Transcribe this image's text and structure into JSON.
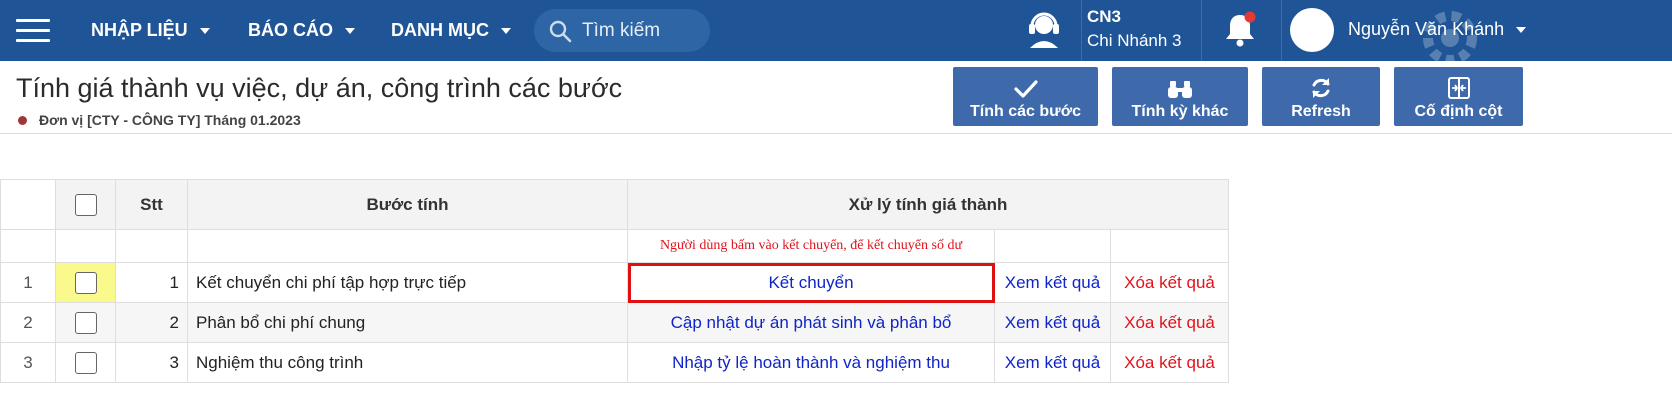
{
  "nav": {
    "menus": [
      {
        "label": "NHẬP LIỆU"
      },
      {
        "label": "BÁO CÁO"
      },
      {
        "label": "DANH MỤC"
      }
    ],
    "search_placeholder": "Tìm kiếm",
    "branch_code": "CN3",
    "branch_name": "Chi Nhánh 3",
    "user_name": "Nguyễn Văn Khánh",
    "colors": {
      "bar": "#1f5597",
      "notification_dot": "#e53935"
    }
  },
  "header": {
    "title": "Tính giá thành vụ việc, dự án, công trình các bước",
    "subtitle": "Đơn vị [CTY - CÔNG TY] Tháng 01.2023"
  },
  "actions": [
    {
      "label": "Tính các bước",
      "icon": "check-icon"
    },
    {
      "label": "Tính kỳ khác",
      "icon": "binoculars-icon"
    },
    {
      "label": "Refresh",
      "icon": "refresh-icon"
    },
    {
      "label": "Cố định cột",
      "icon": "freeze-column-icon"
    }
  ],
  "grid": {
    "headers": {
      "stt": "Stt",
      "step": "Bước tính",
      "process": "Xử lý tính giá thành"
    },
    "note": "Người dùng bấm vào kết chuyển, để kết chuyển số dư",
    "rows": [
      {
        "num": "1",
        "stt": "1",
        "step": "Kết chuyển chi phí tập hợp trực tiếp",
        "action": "Kết chuyển",
        "view": "Xem kết quả",
        "delete": "Xóa kết quả"
      },
      {
        "num": "2",
        "stt": "2",
        "step": "Phân bổ chi phí chung",
        "action": "Cập nhật dự án phát sinh và phân bổ",
        "view": "Xem kết quả",
        "delete": "Xóa kết quả"
      },
      {
        "num": "3",
        "stt": "3",
        "step": "Nghiệm thu công trình",
        "action": "Nhập tỷ lệ hoàn thành và nghiệm thu",
        "view": "Xem kết quả",
        "delete": "Xóa kết quả"
      }
    ]
  }
}
